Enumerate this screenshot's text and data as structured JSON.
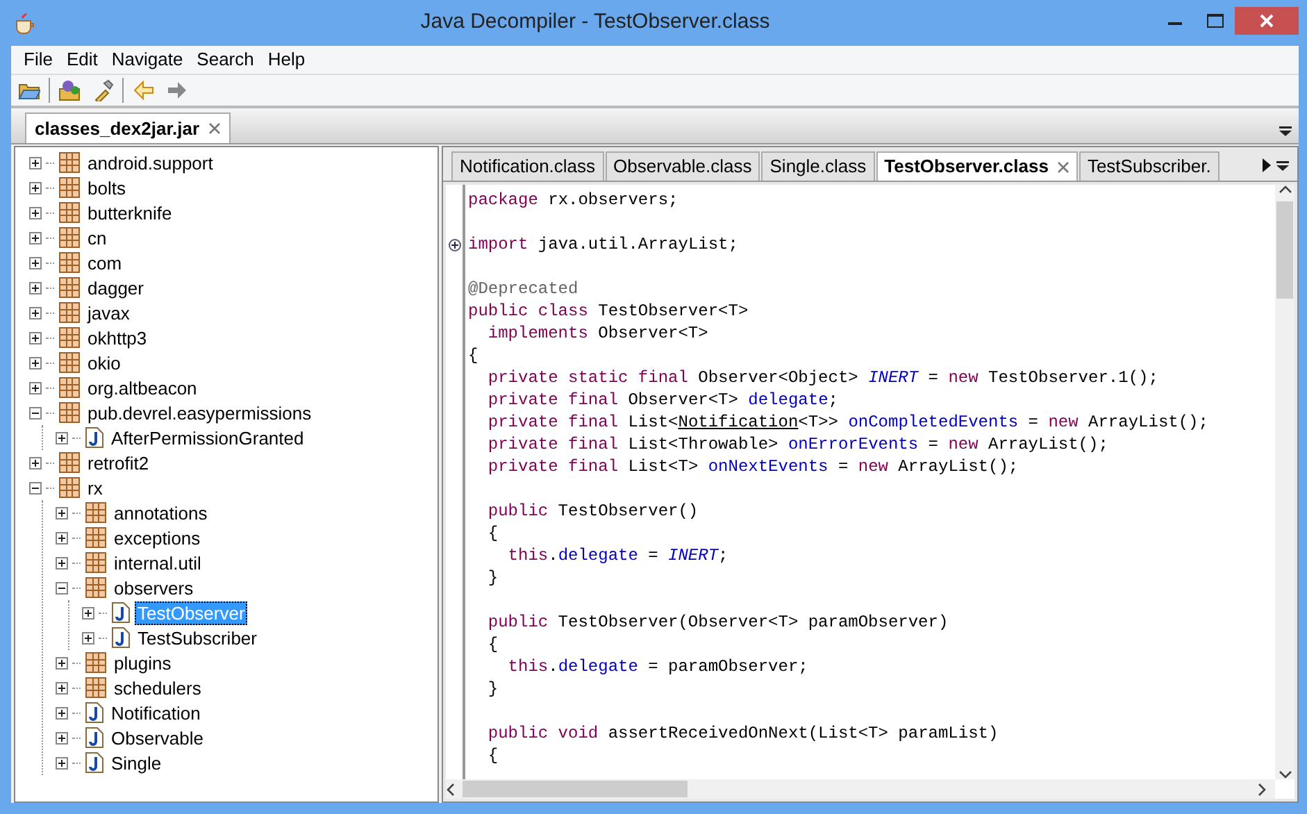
{
  "window": {
    "title": "Java Decompiler - TestObserver.class"
  },
  "menu": [
    "File",
    "Edit",
    "Navigate",
    "Search",
    "Help"
  ],
  "toolbar": [
    {
      "kind": "open"
    },
    {
      "kind": "separator"
    },
    {
      "kind": "open-type"
    },
    {
      "kind": "search"
    },
    {
      "kind": "separator"
    },
    {
      "kind": "back",
      "disabled": false
    },
    {
      "kind": "forward",
      "disabled": true
    }
  ],
  "file_tabs": [
    {
      "label": "classes_dex2jar.jar",
      "selected": true
    }
  ],
  "tree": [
    {
      "label": "android.support",
      "kind": "package",
      "expanded": false,
      "selected": false
    },
    {
      "label": "bolts",
      "kind": "package",
      "expanded": false,
      "selected": false
    },
    {
      "label": "butterknife",
      "kind": "package",
      "expanded": false,
      "selected": false
    },
    {
      "label": "cn",
      "kind": "package",
      "expanded": false,
      "selected": false
    },
    {
      "label": "com",
      "kind": "package",
      "expanded": false,
      "selected": false
    },
    {
      "label": "dagger",
      "kind": "package",
      "expanded": false,
      "selected": false
    },
    {
      "label": "javax",
      "kind": "package",
      "expanded": false,
      "selected": false
    },
    {
      "label": "okhttp3",
      "kind": "package",
      "expanded": false,
      "selected": false
    },
    {
      "label": "okio",
      "kind": "package",
      "expanded": false,
      "selected": false
    },
    {
      "label": "org.altbeacon",
      "kind": "package",
      "expanded": false,
      "selected": false
    },
    {
      "label": "pub.devrel.easypermissions",
      "kind": "package",
      "expanded": true,
      "selected": false,
      "children": [
        {
          "label": "AfterPermissionGranted",
          "kind": "class",
          "expanded": false,
          "selected": false
        }
      ]
    },
    {
      "label": "retrofit2",
      "kind": "package",
      "expanded": false,
      "selected": false
    },
    {
      "label": "rx",
      "kind": "package",
      "expanded": true,
      "selected": false,
      "children": [
        {
          "label": "annotations",
          "kind": "package",
          "expanded": false,
          "selected": false
        },
        {
          "label": "exceptions",
          "kind": "package",
          "expanded": false,
          "selected": false
        },
        {
          "label": "internal.util",
          "kind": "package",
          "expanded": false,
          "selected": false
        },
        {
          "label": "observers",
          "kind": "package",
          "expanded": true,
          "selected": false,
          "children": [
            {
              "label": "TestObserver",
              "kind": "class",
              "expanded": false,
              "selected": true
            },
            {
              "label": "TestSubscriber",
              "kind": "class",
              "expanded": false,
              "selected": false
            }
          ]
        },
        {
          "label": "plugins",
          "kind": "package",
          "expanded": false,
          "selected": false
        },
        {
          "label": "schedulers",
          "kind": "package",
          "expanded": false,
          "selected": false
        },
        {
          "label": "Notification",
          "kind": "class",
          "expanded": false,
          "selected": false
        },
        {
          "label": "Observable",
          "kind": "class",
          "expanded": false,
          "selected": false
        },
        {
          "label": "Single",
          "kind": "class",
          "expanded": false,
          "selected": false
        }
      ]
    }
  ],
  "editor_tabs": [
    {
      "label": "Notification.class",
      "selected": false
    },
    {
      "label": "Observable.class",
      "selected": false
    },
    {
      "label": "Single.class",
      "selected": false
    },
    {
      "label": "TestObserver.class",
      "selected": true
    },
    {
      "label": "TestSubscriber.",
      "selected": false
    }
  ],
  "code": [
    {
      "kind": "code",
      "tokens": [
        {
          "kind": "keyword",
          "text": "package"
        },
        {
          "kind": "plain",
          "text": " rx.observers;"
        }
      ]
    },
    {
      "kind": "blank"
    },
    {
      "kind": "code",
      "folded": true,
      "tokens": [
        {
          "kind": "keyword",
          "text": "import"
        },
        {
          "kind": "plain",
          "text": " java.util.ArrayList;"
        }
      ]
    },
    {
      "kind": "blank"
    },
    {
      "kind": "code",
      "tokens": [
        {
          "kind": "annotation",
          "text": "@Deprecated"
        }
      ]
    },
    {
      "kind": "code",
      "tokens": [
        {
          "kind": "keyword",
          "text": "public class"
        },
        {
          "kind": "plain",
          "text": " TestObserver<T>"
        }
      ]
    },
    {
      "kind": "code",
      "tokens": [
        {
          "kind": "keyword",
          "text": "  implements"
        },
        {
          "kind": "plain",
          "text": " Observer<T>"
        }
      ]
    },
    {
      "kind": "code",
      "tokens": [
        {
          "kind": "plain",
          "text": "{"
        }
      ]
    },
    {
      "kind": "code",
      "tokens": [
        {
          "kind": "keyword",
          "text": "  private static final"
        },
        {
          "kind": "plain",
          "text": " Observer<Object> "
        },
        {
          "kind": "static",
          "text": "INERT"
        },
        {
          "kind": "plain",
          "text": " = "
        },
        {
          "kind": "keyword",
          "text": "new"
        },
        {
          "kind": "plain",
          "text": " TestObserver.1();"
        }
      ]
    },
    {
      "kind": "code",
      "tokens": [
        {
          "kind": "keyword",
          "text": "  private final"
        },
        {
          "kind": "plain",
          "text": " Observer<T> "
        },
        {
          "kind": "field",
          "text": "delegate"
        },
        {
          "kind": "plain",
          "text": ";"
        }
      ]
    },
    {
      "kind": "code",
      "tokens": [
        {
          "kind": "keyword",
          "text": "  private final"
        },
        {
          "kind": "plain",
          "text": " List<"
        },
        {
          "kind": "link",
          "text": "Notification"
        },
        {
          "kind": "plain",
          "text": "<T>> "
        },
        {
          "kind": "field",
          "text": "onCompletedEvents"
        },
        {
          "kind": "plain",
          "text": " = "
        },
        {
          "kind": "keyword",
          "text": "new"
        },
        {
          "kind": "plain",
          "text": " ArrayList();"
        }
      ]
    },
    {
      "kind": "code",
      "tokens": [
        {
          "kind": "keyword",
          "text": "  private final"
        },
        {
          "kind": "plain",
          "text": " List<Throwable> "
        },
        {
          "kind": "field",
          "text": "onErrorEvents"
        },
        {
          "kind": "plain",
          "text": " = "
        },
        {
          "kind": "keyword",
          "text": "new"
        },
        {
          "kind": "plain",
          "text": " ArrayList();"
        }
      ]
    },
    {
      "kind": "code",
      "tokens": [
        {
          "kind": "keyword",
          "text": "  private final"
        },
        {
          "kind": "plain",
          "text": " List<T> "
        },
        {
          "kind": "field",
          "text": "onNextEvents"
        },
        {
          "kind": "plain",
          "text": " = "
        },
        {
          "kind": "keyword",
          "text": "new"
        },
        {
          "kind": "plain",
          "text": " ArrayList();"
        }
      ]
    },
    {
      "kind": "blank"
    },
    {
      "kind": "code",
      "tokens": [
        {
          "kind": "keyword",
          "text": "  public"
        },
        {
          "kind": "plain",
          "text": " TestObserver()"
        }
      ]
    },
    {
      "kind": "code",
      "tokens": [
        {
          "kind": "plain",
          "text": "  {"
        }
      ]
    },
    {
      "kind": "code",
      "tokens": [
        {
          "kind": "keyword",
          "text": "    this"
        },
        {
          "kind": "plain",
          "text": "."
        },
        {
          "kind": "field",
          "text": "delegate"
        },
        {
          "kind": "plain",
          "text": " = "
        },
        {
          "kind": "static",
          "text": "INERT"
        },
        {
          "kind": "plain",
          "text": ";"
        }
      ]
    },
    {
      "kind": "code",
      "tokens": [
        {
          "kind": "plain",
          "text": "  }"
        }
      ]
    },
    {
      "kind": "blank"
    },
    {
      "kind": "code",
      "tokens": [
        {
          "kind": "keyword",
          "text": "  public"
        },
        {
          "kind": "plain",
          "text": " TestObserver(Observer<T> paramObserver)"
        }
      ]
    },
    {
      "kind": "code",
      "tokens": [
        {
          "kind": "plain",
          "text": "  {"
        }
      ]
    },
    {
      "kind": "code",
      "tokens": [
        {
          "kind": "keyword",
          "text": "    this"
        },
        {
          "kind": "plain",
          "text": "."
        },
        {
          "kind": "field",
          "text": "delegate"
        },
        {
          "kind": "plain",
          "text": " = paramObserver;"
        }
      ]
    },
    {
      "kind": "code",
      "tokens": [
        {
          "kind": "plain",
          "text": "  }"
        }
      ]
    },
    {
      "kind": "blank"
    },
    {
      "kind": "code",
      "tokens": [
        {
          "kind": "keyword",
          "text": "  public void"
        },
        {
          "kind": "plain",
          "text": " assertReceivedOnNext(List<T> paramList)"
        }
      ]
    },
    {
      "kind": "code",
      "tokens": [
        {
          "kind": "plain",
          "text": "  {"
        }
      ]
    }
  ]
}
